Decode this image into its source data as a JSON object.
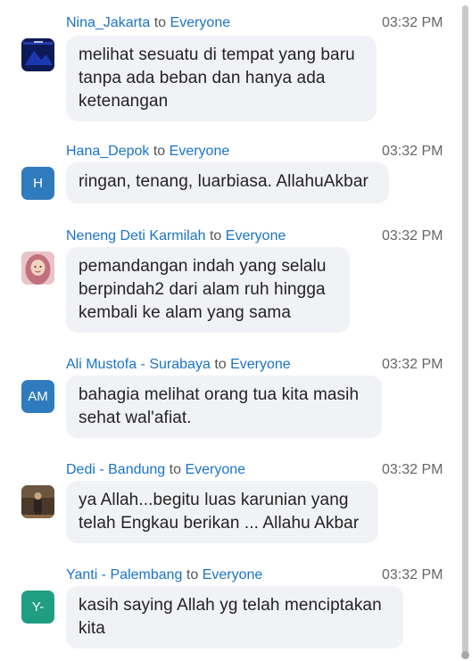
{
  "connector": "to",
  "messages": [
    {
      "sender": "Nina_Jakarta",
      "target": "Everyone",
      "time": "03:32 PM",
      "avatar_type": "photo-dark-blue",
      "avatar_text": "",
      "avatar_color": "#1b2e7a",
      "text": "melihat sesuatu di tempat yang baru tanpa ada beban dan hanya ada ketenangan"
    },
    {
      "sender": "Hana_Depok",
      "target": "Everyone",
      "time": "03:32 PM",
      "avatar_type": "initials",
      "avatar_text": "H",
      "avatar_color": "#2f7bbd",
      "text": "ringan, tenang, luarbiasa. AllahuAkbar"
    },
    {
      "sender": "Neneng Deti Karmilah",
      "target": "Everyone",
      "time": "03:32 PM",
      "avatar_type": "photo-hijab",
      "avatar_text": "",
      "avatar_color": "#c97a84",
      "text": "pemandangan indah yang selalu berpindah2 dari alam ruh hingga kembali ke alam yang sama"
    },
    {
      "sender": "Ali Mustofa - Surabaya",
      "target": "Everyone",
      "time": "03:32 PM",
      "avatar_type": "initials",
      "avatar_text": "AM",
      "avatar_color": "#2f7bbd",
      "text": "bahagia melihat orang tua kita masih sehat wal'afiat."
    },
    {
      "sender": "Dedi - Bandung",
      "target": "Everyone",
      "time": "03:32 PM",
      "avatar_type": "photo-person",
      "avatar_color": "#5a4634",
      "avatar_text": "",
      "text": "ya Allah...begitu luas karunian yang telah Engkau berikan ... Allahu Akbar"
    },
    {
      "sender": "Yanti - Palembang",
      "target": "Everyone",
      "time": "03:32 PM",
      "avatar_type": "initials",
      "avatar_text": "Y-",
      "avatar_color": "#1f9e82",
      "text": "kasih saying Allah yg telah menciptakan kita"
    }
  ]
}
